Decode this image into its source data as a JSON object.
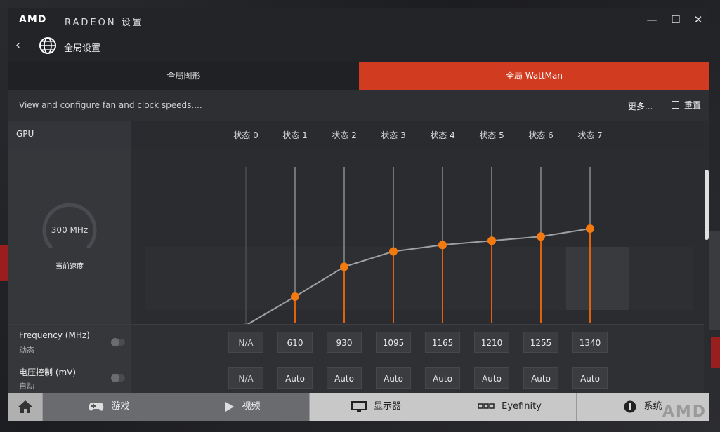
{
  "window": {
    "brand": "AMD",
    "brand_sub": "RADEON 设置",
    "controls": {
      "minimize": "—",
      "maximize": "☐",
      "close": "✕"
    }
  },
  "nav": {
    "back": "‹",
    "title": "全局设置"
  },
  "tabs": [
    {
      "label": "全局图形",
      "active": false
    },
    {
      "label": "全局 WattMan",
      "active": true
    }
  ],
  "info": {
    "description": "View and configure fan and clock speeds....",
    "more": "更多...",
    "reset": "重置"
  },
  "gpu": {
    "label": "GPU",
    "current_speed": "300 MHz",
    "current_speed_label": "当前速度",
    "states": [
      "状态 0",
      "状态 1",
      "状态 2",
      "状态 3",
      "状态 4",
      "状态 5",
      "状态 6",
      "状态 7"
    ]
  },
  "chart_data": {
    "type": "line",
    "categories": [
      "状态 0",
      "状态 1",
      "状态 2",
      "状态 3",
      "状态 4",
      "状态 5",
      "状态 6",
      "状态 7"
    ],
    "values": [
      300,
      610,
      930,
      1095,
      1165,
      1210,
      1255,
      1340
    ],
    "ylim": [
      300,
      1340
    ],
    "colors": {
      "line": "#9fa0a4",
      "point": "#f47a10",
      "stem": "#e0620c",
      "stem_inactive": "#5a5b5f"
    }
  },
  "frequency_row": {
    "title": "Frequency (MHz)",
    "subtitle": "动态",
    "values": [
      "N/A",
      "610",
      "930",
      "1095",
      "1165",
      "1210",
      "1255",
      "1340"
    ]
  },
  "voltage_row": {
    "title": "电压控制 (mV)",
    "subtitle": "自动",
    "values": [
      "N/A",
      "Auto",
      "Auto",
      "Auto",
      "Auto",
      "Auto",
      "Auto",
      "Auto"
    ]
  },
  "bottom_nav": {
    "games": "游戏",
    "video": "视频",
    "display": "显示器",
    "eyefinity": "Eyefinity",
    "system": "系统",
    "watermark": "AMD"
  },
  "colors": {
    "accent": "#d13b1f"
  }
}
